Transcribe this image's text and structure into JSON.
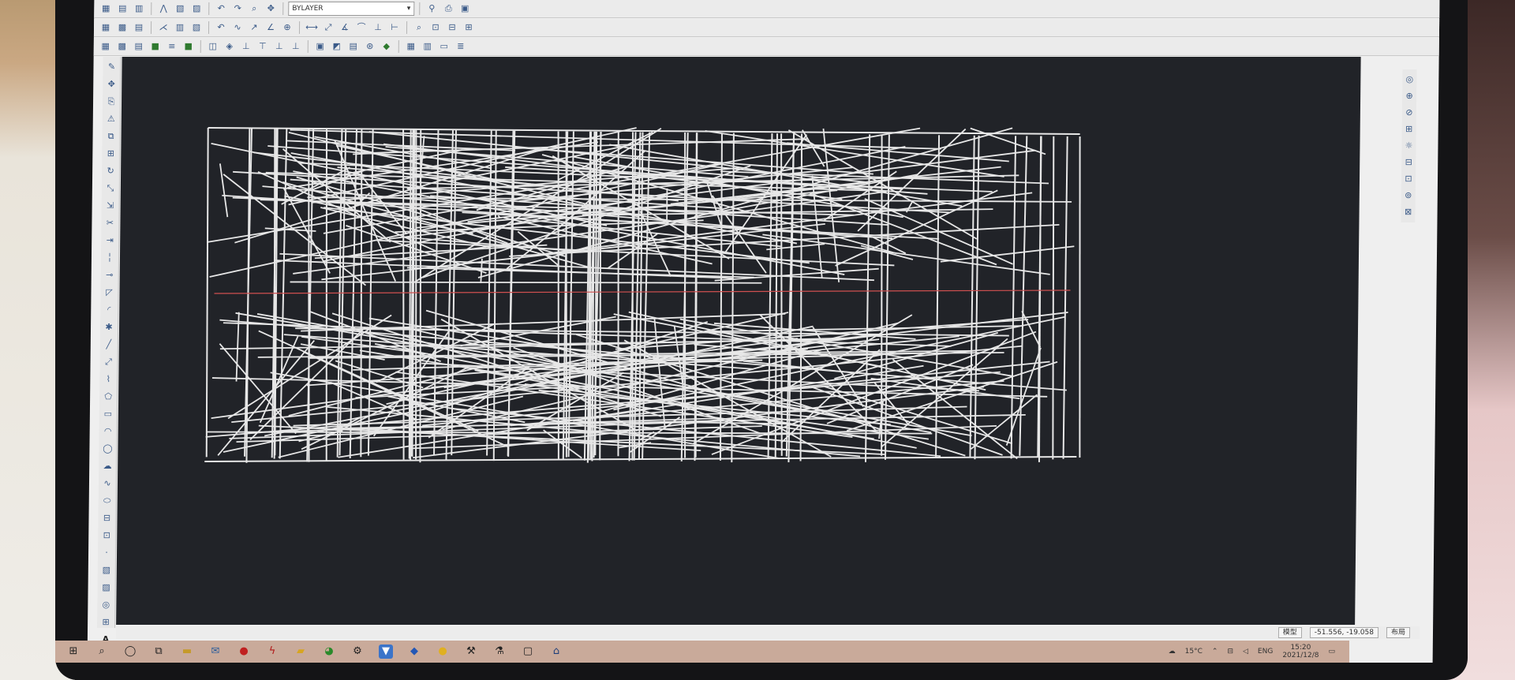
{
  "toolbar": {
    "row1_icons": [
      "layers-icon",
      "layer-props-icon",
      "layer-state-icon",
      "match-icon",
      "array-icon",
      "block-icon",
      "table-icon",
      "undo-icon",
      "redo-icon",
      "zoom-icon",
      "pan-icon",
      "find-icon",
      "plot-icon",
      "print-icon"
    ],
    "layer_combo_value": "BYLAYER",
    "row2_icons": [
      "distance-icon",
      "area-icon",
      "dimension-icon",
      "leader-icon",
      "text-icon",
      "hatch-icon",
      "measure-icon",
      "angle-icon",
      "arc-length-icon",
      "radius-icon",
      "zoom-window-icon",
      "zoom-extents-icon",
      "zoom-prev-icon"
    ],
    "row3_icons": [
      "snap-icon",
      "grid-icon",
      "ortho-icon",
      "polar-icon",
      "osnap-icon",
      "otrack-icon",
      "ducs-icon",
      "dyn-icon",
      "lwt-icon",
      "qp-icon",
      "model-icon",
      "layout-icon",
      "viewport-icon",
      "annotation-icon"
    ]
  },
  "palette": {
    "icons": [
      "pencil-icon",
      "move-icon",
      "copy-icon",
      "mirror-icon",
      "offset-icon",
      "array-icon",
      "rotate-icon",
      "scale-icon",
      "stretch-icon",
      "trim-icon",
      "extend-icon",
      "break-icon",
      "join-icon",
      "chamfer-icon",
      "fillet-icon",
      "explode-icon",
      "line-icon",
      "xline-icon",
      "polyline-icon",
      "polygon-icon",
      "rectangle-icon",
      "arc-icon",
      "circle-icon",
      "revcloud-icon",
      "spline-icon",
      "ellipse-icon",
      "insert-icon",
      "block-icon",
      "point-icon",
      "hatch-icon",
      "gradient-icon",
      "region-icon",
      "table-icon",
      "mtext-icon"
    ],
    "text_tool_label": "A"
  },
  "palette_right": {
    "icons": [
      "orbit-icon",
      "walk-icon",
      "view-icon",
      "camera-icon",
      "light-icon",
      "material-icon",
      "render-icon",
      "sun-icon",
      "fog-icon"
    ]
  },
  "canvas": {
    "background": "#212328",
    "line_color": "#e7e7e7",
    "axis_color": "#d05050"
  },
  "status": {
    "coords": "-51.556, -19.058",
    "left_label": "模型",
    "right_label": "布局"
  },
  "taskbar": {
    "apps": [
      "start-icon",
      "search-icon",
      "cortana-icon",
      "task-view-icon",
      "explorer-icon",
      "mail-icon",
      "office-icon",
      "flash-icon",
      "folder-icon",
      "chrome-icon",
      "settings-icon",
      "cad-icon",
      "blue-app-icon",
      "yellow-app-icon",
      "tool-icon",
      "tool2-icon",
      "window-icon",
      "store-icon"
    ],
    "weather": "15°C",
    "ime": "ENG",
    "time": "15:20",
    "date": "2021/12/8"
  }
}
